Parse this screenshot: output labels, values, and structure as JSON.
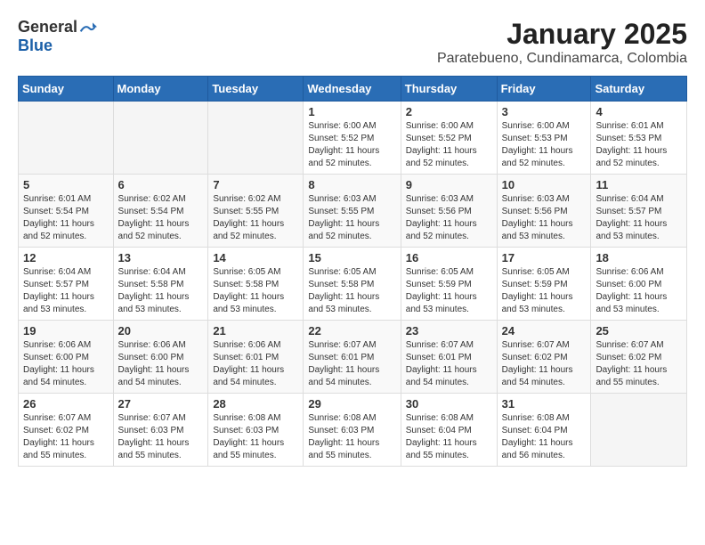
{
  "logo": {
    "general": "General",
    "blue": "Blue"
  },
  "title": "January 2025",
  "location": "Paratebueno, Cundinamarca, Colombia",
  "weekdays": [
    "Sunday",
    "Monday",
    "Tuesday",
    "Wednesday",
    "Thursday",
    "Friday",
    "Saturday"
  ],
  "weeks": [
    [
      {
        "day": "",
        "sunrise": "",
        "sunset": "",
        "daylight": ""
      },
      {
        "day": "",
        "sunrise": "",
        "sunset": "",
        "daylight": ""
      },
      {
        "day": "",
        "sunrise": "",
        "sunset": "",
        "daylight": ""
      },
      {
        "day": "1",
        "sunrise": "Sunrise: 6:00 AM",
        "sunset": "Sunset: 5:52 PM",
        "daylight": "Daylight: 11 hours and 52 minutes."
      },
      {
        "day": "2",
        "sunrise": "Sunrise: 6:00 AM",
        "sunset": "Sunset: 5:52 PM",
        "daylight": "Daylight: 11 hours and 52 minutes."
      },
      {
        "day": "3",
        "sunrise": "Sunrise: 6:00 AM",
        "sunset": "Sunset: 5:53 PM",
        "daylight": "Daylight: 11 hours and 52 minutes."
      },
      {
        "day": "4",
        "sunrise": "Sunrise: 6:01 AM",
        "sunset": "Sunset: 5:53 PM",
        "daylight": "Daylight: 11 hours and 52 minutes."
      }
    ],
    [
      {
        "day": "5",
        "sunrise": "Sunrise: 6:01 AM",
        "sunset": "Sunset: 5:54 PM",
        "daylight": "Daylight: 11 hours and 52 minutes."
      },
      {
        "day": "6",
        "sunrise": "Sunrise: 6:02 AM",
        "sunset": "Sunset: 5:54 PM",
        "daylight": "Daylight: 11 hours and 52 minutes."
      },
      {
        "day": "7",
        "sunrise": "Sunrise: 6:02 AM",
        "sunset": "Sunset: 5:55 PM",
        "daylight": "Daylight: 11 hours and 52 minutes."
      },
      {
        "day": "8",
        "sunrise": "Sunrise: 6:03 AM",
        "sunset": "Sunset: 5:55 PM",
        "daylight": "Daylight: 11 hours and 52 minutes."
      },
      {
        "day": "9",
        "sunrise": "Sunrise: 6:03 AM",
        "sunset": "Sunset: 5:56 PM",
        "daylight": "Daylight: 11 hours and 52 minutes."
      },
      {
        "day": "10",
        "sunrise": "Sunrise: 6:03 AM",
        "sunset": "Sunset: 5:56 PM",
        "daylight": "Daylight: 11 hours and 53 minutes."
      },
      {
        "day": "11",
        "sunrise": "Sunrise: 6:04 AM",
        "sunset": "Sunset: 5:57 PM",
        "daylight": "Daylight: 11 hours and 53 minutes."
      }
    ],
    [
      {
        "day": "12",
        "sunrise": "Sunrise: 6:04 AM",
        "sunset": "Sunset: 5:57 PM",
        "daylight": "Daylight: 11 hours and 53 minutes."
      },
      {
        "day": "13",
        "sunrise": "Sunrise: 6:04 AM",
        "sunset": "Sunset: 5:58 PM",
        "daylight": "Daylight: 11 hours and 53 minutes."
      },
      {
        "day": "14",
        "sunrise": "Sunrise: 6:05 AM",
        "sunset": "Sunset: 5:58 PM",
        "daylight": "Daylight: 11 hours and 53 minutes."
      },
      {
        "day": "15",
        "sunrise": "Sunrise: 6:05 AM",
        "sunset": "Sunset: 5:58 PM",
        "daylight": "Daylight: 11 hours and 53 minutes."
      },
      {
        "day": "16",
        "sunrise": "Sunrise: 6:05 AM",
        "sunset": "Sunset: 5:59 PM",
        "daylight": "Daylight: 11 hours and 53 minutes."
      },
      {
        "day": "17",
        "sunrise": "Sunrise: 6:05 AM",
        "sunset": "Sunset: 5:59 PM",
        "daylight": "Daylight: 11 hours and 53 minutes."
      },
      {
        "day": "18",
        "sunrise": "Sunrise: 6:06 AM",
        "sunset": "Sunset: 6:00 PM",
        "daylight": "Daylight: 11 hours and 53 minutes."
      }
    ],
    [
      {
        "day": "19",
        "sunrise": "Sunrise: 6:06 AM",
        "sunset": "Sunset: 6:00 PM",
        "daylight": "Daylight: 11 hours and 54 minutes."
      },
      {
        "day": "20",
        "sunrise": "Sunrise: 6:06 AM",
        "sunset": "Sunset: 6:00 PM",
        "daylight": "Daylight: 11 hours and 54 minutes."
      },
      {
        "day": "21",
        "sunrise": "Sunrise: 6:06 AM",
        "sunset": "Sunset: 6:01 PM",
        "daylight": "Daylight: 11 hours and 54 minutes."
      },
      {
        "day": "22",
        "sunrise": "Sunrise: 6:07 AM",
        "sunset": "Sunset: 6:01 PM",
        "daylight": "Daylight: 11 hours and 54 minutes."
      },
      {
        "day": "23",
        "sunrise": "Sunrise: 6:07 AM",
        "sunset": "Sunset: 6:01 PM",
        "daylight": "Daylight: 11 hours and 54 minutes."
      },
      {
        "day": "24",
        "sunrise": "Sunrise: 6:07 AM",
        "sunset": "Sunset: 6:02 PM",
        "daylight": "Daylight: 11 hours and 54 minutes."
      },
      {
        "day": "25",
        "sunrise": "Sunrise: 6:07 AM",
        "sunset": "Sunset: 6:02 PM",
        "daylight": "Daylight: 11 hours and 55 minutes."
      }
    ],
    [
      {
        "day": "26",
        "sunrise": "Sunrise: 6:07 AM",
        "sunset": "Sunset: 6:02 PM",
        "daylight": "Daylight: 11 hours and 55 minutes."
      },
      {
        "day": "27",
        "sunrise": "Sunrise: 6:07 AM",
        "sunset": "Sunset: 6:03 PM",
        "daylight": "Daylight: 11 hours and 55 minutes."
      },
      {
        "day": "28",
        "sunrise": "Sunrise: 6:08 AM",
        "sunset": "Sunset: 6:03 PM",
        "daylight": "Daylight: 11 hours and 55 minutes."
      },
      {
        "day": "29",
        "sunrise": "Sunrise: 6:08 AM",
        "sunset": "Sunset: 6:03 PM",
        "daylight": "Daylight: 11 hours and 55 minutes."
      },
      {
        "day": "30",
        "sunrise": "Sunrise: 6:08 AM",
        "sunset": "Sunset: 6:04 PM",
        "daylight": "Daylight: 11 hours and 55 minutes."
      },
      {
        "day": "31",
        "sunrise": "Sunrise: 6:08 AM",
        "sunset": "Sunset: 6:04 PM",
        "daylight": "Daylight: 11 hours and 56 minutes."
      },
      {
        "day": "",
        "sunrise": "",
        "sunset": "",
        "daylight": ""
      }
    ]
  ]
}
